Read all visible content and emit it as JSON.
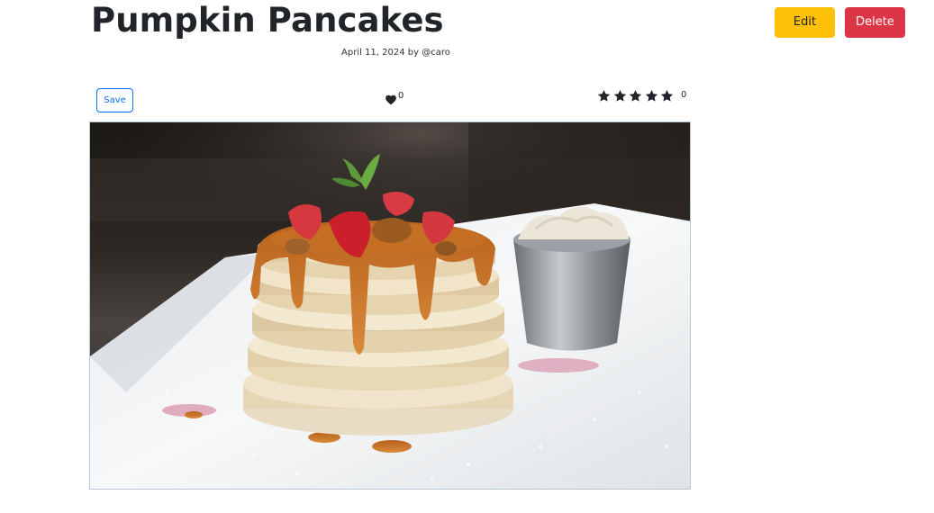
{
  "recipe": {
    "title": "Pumpkin Pancakes",
    "date": "April 11, 2024",
    "by_label": "by",
    "author": "@caro"
  },
  "actions": {
    "edit_label": "Edit",
    "delete_label": "Delete",
    "save_label": "Save"
  },
  "likes": {
    "icon": "heart-icon",
    "count": "0"
  },
  "rating": {
    "icon": "star-icon",
    "stars_shown": 5,
    "count": "0"
  },
  "image": {
    "alt": "Pumpkin Pancakes"
  },
  "colors": {
    "edit": "#ffc107",
    "delete": "#dc3545",
    "save": "#0d6efd",
    "image_border": "#b8c7d6"
  }
}
